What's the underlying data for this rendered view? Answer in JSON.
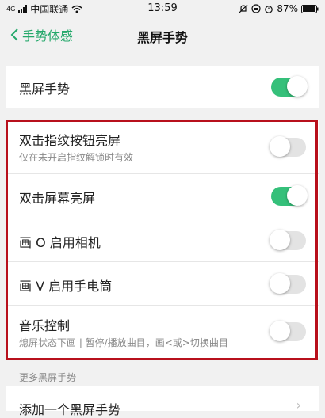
{
  "status": {
    "carrier": "中国联通",
    "network_badge": "4G",
    "time": "13:59",
    "battery": "87%"
  },
  "nav": {
    "back_label": "手势体感",
    "title": "黑屏手势"
  },
  "master": {
    "label": "黑屏手势",
    "on": true
  },
  "gestures": [
    {
      "label": "双击指纹按钮亮屏",
      "sub": "仅在未开启指纹解锁时有效",
      "on": false
    },
    {
      "label": "双击屏幕亮屏",
      "on": true
    },
    {
      "label": "画 O 启用相机",
      "on": false
    },
    {
      "label": "画 V 启用手电筒",
      "on": false
    },
    {
      "label": "音乐控制",
      "sub": "熄屏状态下画 | 暂停/播放曲目，画<或>切换曲目",
      "on": false
    }
  ],
  "more_section": {
    "title": "更多黑屏手势",
    "add_label": "添加一个黑屏手势"
  },
  "colors": {
    "accent": "#24a86a",
    "toggle_on": "#35c07a",
    "highlight_border": "#b8101c"
  }
}
